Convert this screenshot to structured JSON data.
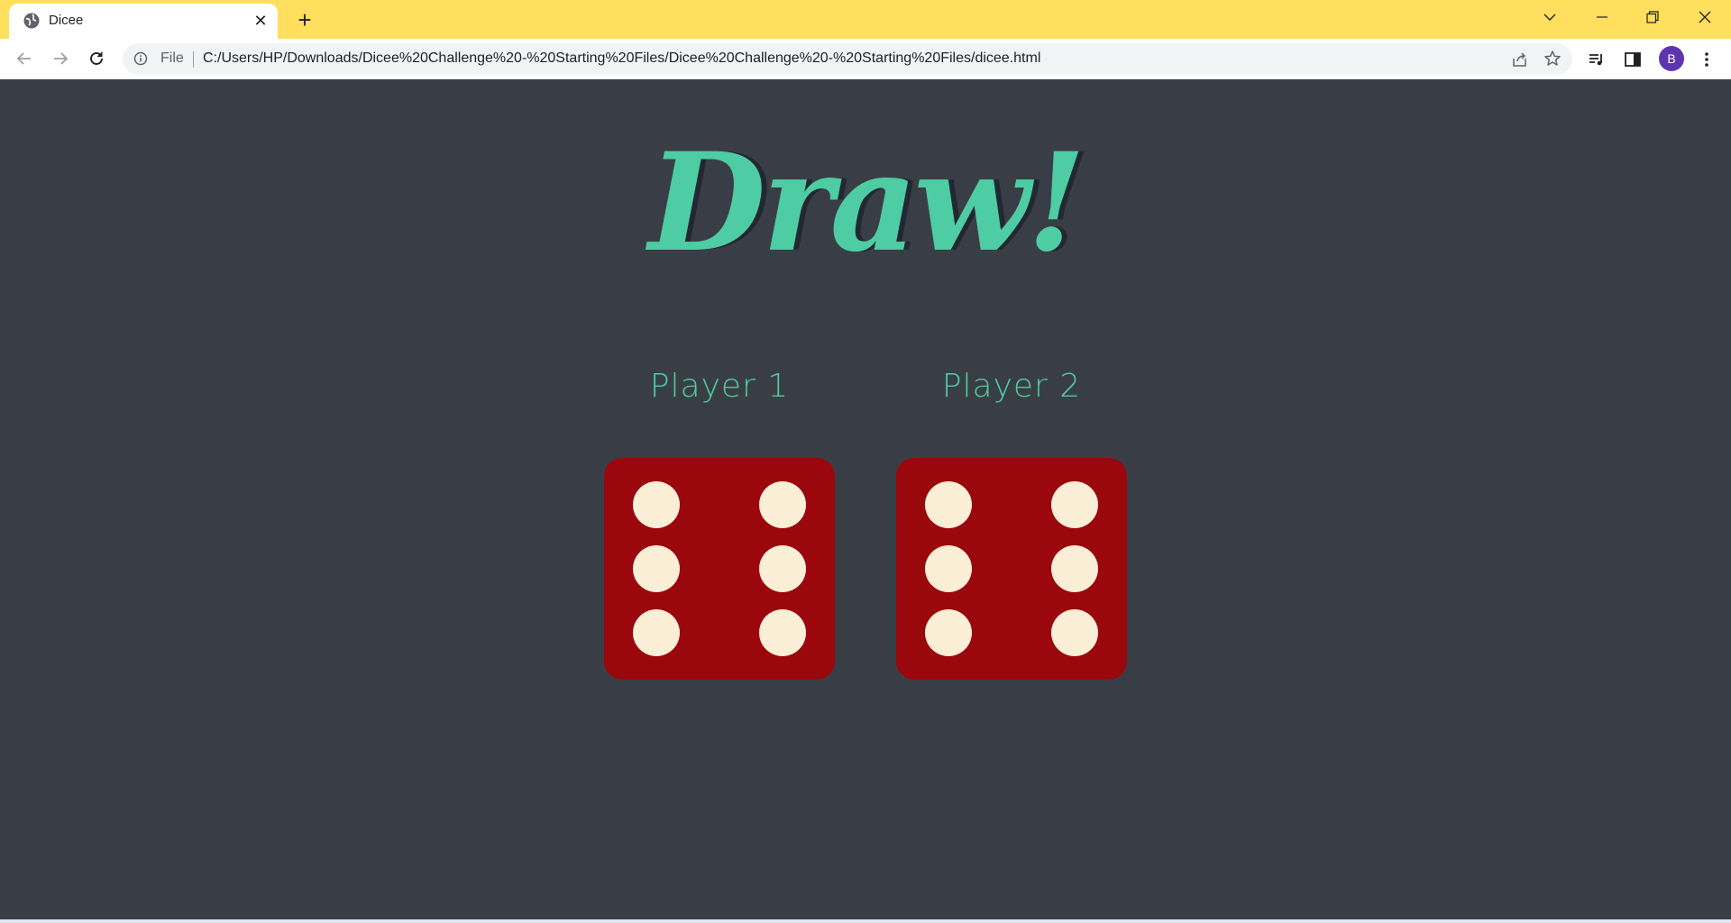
{
  "browser": {
    "tab": {
      "title": "Dicee",
      "close_glyph": "✕"
    },
    "new_tab_glyph": "+",
    "address": {
      "scheme_label": "File",
      "url": "C:/Users/HP/Downloads/Dicee%20Challenge%20-%20Starting%20Files/Dicee%20Challenge%20-%20Starting%20Files/dicee.html"
    },
    "profile_initial": "B"
  },
  "page": {
    "headline": "Draw!",
    "players": [
      {
        "label": "Player 1",
        "die_value": 6
      },
      {
        "label": "Player 2",
        "die_value": 6
      }
    ],
    "colors": {
      "background": "#393e46",
      "accent": "#4ecca3",
      "shadow": "#222831",
      "die": "#9a070d",
      "pip": "#faeed6",
      "browser_frame": "#ffdf5d"
    }
  }
}
